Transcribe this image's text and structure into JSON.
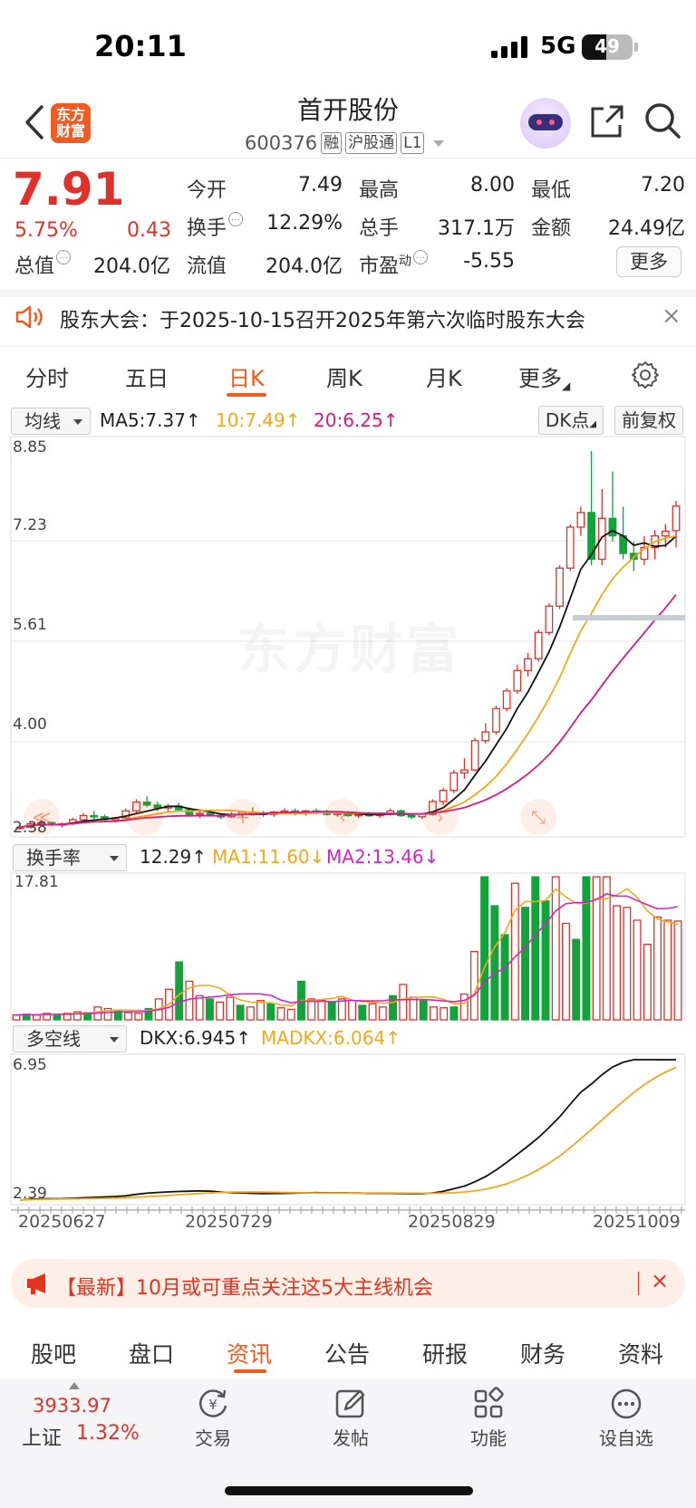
{
  "status_bar": {
    "time": "20:11",
    "network": "5G",
    "battery": "49"
  },
  "header": {
    "name": "首开股份",
    "code": "600376",
    "tags": [
      "融",
      "沪股通",
      "L1"
    ],
    "logo_text": "东方财富"
  },
  "quote": {
    "price": "7.91",
    "change_pct": "5.75%",
    "change": "0.43",
    "fields": [
      {
        "label": "今开",
        "value": "7.49",
        "tone": "red",
        "info": false
      },
      {
        "label": "最高",
        "value": "8.00",
        "tone": "red",
        "info": false
      },
      {
        "label": "最低",
        "value": "7.20",
        "tone": "green",
        "info": false
      },
      {
        "label": "换手",
        "value": "12.29%",
        "tone": "normal",
        "info": true
      },
      {
        "label": "总手",
        "value": "317.1万",
        "tone": "normal",
        "info": false
      },
      {
        "label": "金额",
        "value": "24.49亿",
        "tone": "normal",
        "info": false
      },
      {
        "label": "总值",
        "value": "204.0亿",
        "tone": "normal",
        "info": true
      },
      {
        "label": "流值",
        "value": "204.0亿",
        "tone": "normal",
        "info": false
      },
      {
        "label": "市盈",
        "superscript": "动",
        "value": "-5.55",
        "tone": "normal",
        "info": true
      }
    ],
    "more_label": "更多"
  },
  "notice": {
    "text": "股东大会：于2025-10-15召开2025年第六次临时股东大会",
    "close": "×"
  },
  "period_tabs": [
    "分时",
    "五日",
    "日K",
    "周K",
    "月K",
    "更多"
  ],
  "kline": {
    "indicator_select": "均线",
    "ma5": "MA5:7.37↑",
    "ma10": "10:7.49↑",
    "ma20": "20:6.25↑",
    "dk_button": "DK点",
    "adjust_button": "前复权",
    "y_labels": [
      "8.85",
      "7.23",
      "5.61",
      "4.00",
      "2.38"
    ],
    "watermark": "东方财富"
  },
  "turnover": {
    "select": "换手率",
    "value": "12.29↑",
    "ma1": "MA1:11.60↓",
    "ma2": "MA2:13.46↓",
    "max_label": "17.81"
  },
  "dkx": {
    "select": "多空线",
    "dkx": "DKX:6.945↑",
    "madkx": "MADKX:6.064↑",
    "max_label": "6.95",
    "min_label": "2.39",
    "dates": [
      "20250627",
      "20250729",
      "20250829",
      "20251009"
    ]
  },
  "chart_data": [
    {
      "type": "candlestick",
      "title": "日K",
      "ylim": [
        2.38,
        8.85
      ],
      "x": [
        "20250627",
        "20250729",
        "20250829",
        "20251009"
      ],
      "series": [
        {
          "name": "MA5",
          "last": 7.37
        },
        {
          "name": "10",
          "last": 7.49
        },
        {
          "name": "20",
          "last": 6.25
        }
      ],
      "ohlc_approx": [
        [
          2.4,
          2.45,
          2.38,
          2.42
        ],
        [
          2.42,
          2.5,
          2.4,
          2.48
        ],
        [
          2.48,
          2.55,
          2.45,
          2.5
        ],
        [
          2.5,
          2.52,
          2.44,
          2.46
        ],
        [
          2.46,
          2.5,
          2.42,
          2.48
        ],
        [
          2.48,
          2.58,
          2.46,
          2.55
        ],
        [
          2.55,
          2.66,
          2.5,
          2.62
        ],
        [
          2.62,
          2.7,
          2.56,
          2.6
        ],
        [
          2.6,
          2.64,
          2.52,
          2.55
        ],
        [
          2.55,
          2.6,
          2.5,
          2.58
        ],
        [
          2.58,
          2.74,
          2.56,
          2.7
        ],
        [
          2.7,
          2.9,
          2.66,
          2.85
        ],
        [
          2.85,
          2.95,
          2.76,
          2.8
        ],
        [
          2.8,
          2.86,
          2.7,
          2.75
        ],
        [
          2.75,
          2.82,
          2.68,
          2.78
        ],
        [
          2.78,
          2.84,
          2.7,
          2.72
        ],
        [
          2.72,
          2.76,
          2.6,
          2.64
        ],
        [
          2.64,
          2.7,
          2.58,
          2.66
        ],
        [
          2.66,
          2.72,
          2.6,
          2.62
        ],
        [
          2.62,
          2.66,
          2.56,
          2.6
        ],
        [
          2.6,
          2.68,
          2.58,
          2.64
        ],
        [
          2.64,
          2.7,
          2.6,
          2.68
        ],
        [
          2.68,
          2.76,
          2.62,
          2.66
        ],
        [
          2.66,
          2.7,
          2.6,
          2.64
        ],
        [
          2.64,
          2.7,
          2.6,
          2.68
        ],
        [
          2.68,
          2.74,
          2.64,
          2.7
        ],
        [
          2.7,
          2.74,
          2.62,
          2.66
        ],
        [
          2.66,
          2.72,
          2.62,
          2.7
        ],
        [
          2.7,
          2.74,
          2.64,
          2.68
        ],
        [
          2.68,
          2.72,
          2.62,
          2.64
        ],
        [
          2.64,
          2.7,
          2.6,
          2.66
        ],
        [
          2.66,
          2.7,
          2.6,
          2.62
        ],
        [
          2.62,
          2.66,
          2.58,
          2.64
        ],
        [
          2.64,
          2.68,
          2.6,
          2.62
        ],
        [
          2.62,
          2.68,
          2.58,
          2.66
        ],
        [
          2.66,
          2.74,
          2.62,
          2.7
        ],
        [
          2.7,
          2.72,
          2.6,
          2.62
        ],
        [
          2.62,
          2.66,
          2.56,
          2.6
        ],
        [
          2.6,
          2.66,
          2.56,
          2.64
        ],
        [
          2.64,
          2.9,
          2.62,
          2.86
        ],
        [
          2.86,
          3.1,
          2.8,
          3.05
        ],
        [
          3.05,
          3.4,
          3.0,
          3.35
        ],
        [
          3.35,
          3.6,
          3.25,
          3.4
        ],
        [
          3.4,
          3.95,
          3.38,
          3.9
        ],
        [
          3.9,
          4.2,
          3.85,
          4.05
        ],
        [
          4.05,
          4.5,
          4.0,
          4.45
        ],
        [
          4.45,
          4.8,
          4.4,
          4.75
        ],
        [
          4.75,
          5.2,
          4.7,
          5.1
        ],
        [
          5.1,
          5.4,
          5.0,
          5.3
        ],
        [
          5.3,
          5.8,
          5.25,
          5.75
        ],
        [
          5.75,
          6.25,
          5.7,
          6.2
        ],
        [
          6.2,
          6.9,
          6.15,
          6.85
        ],
        [
          6.85,
          7.6,
          6.8,
          7.55
        ],
        [
          7.55,
          7.9,
          7.4,
          7.8
        ],
        [
          7.8,
          8.85,
          6.9,
          7.0
        ],
        [
          7.0,
          8.2,
          6.9,
          7.7
        ],
        [
          7.7,
          8.5,
          7.3,
          7.4
        ],
        [
          7.4,
          7.9,
          7.0,
          7.1
        ],
        [
          7.1,
          7.3,
          6.8,
          7.0
        ],
        [
          7.0,
          7.4,
          6.9,
          7.2
        ],
        [
          7.2,
          7.5,
          7.0,
          7.4
        ],
        [
          7.4,
          7.6,
          7.2,
          7.48
        ],
        [
          7.49,
          8.0,
          7.2,
          7.91
        ]
      ]
    },
    {
      "type": "bar",
      "title": "换手率",
      "ylim": [
        0,
        17.81
      ],
      "series": [
        {
          "name": "MA1",
          "last": 11.6
        },
        {
          "name": "MA2",
          "last": 13.46
        }
      ],
      "values_approx": [
        0.6,
        0.7,
        0.6,
        0.8,
        0.7,
        0.8,
        1.0,
        0.9,
        1.6,
        1.4,
        1.2,
        0.9,
        0.8,
        1.4,
        2.6,
        3.8,
        7.2,
        4.8,
        3.0,
        2.6,
        2.2,
        2.8,
        1.8,
        1.6,
        2.4,
        2.0,
        1.5,
        1.3,
        4.8,
        2.6,
        2.4,
        2.2,
        2.6,
        2.4,
        1.8,
        2.0,
        1.6,
        3.0,
        4.4,
        2.8,
        2.4,
        1.6,
        1.5,
        1.6,
        3.2,
        8.5,
        17.8,
        14.2,
        10.6,
        17.0,
        14.0,
        17.8,
        14.8,
        17.8,
        12.0,
        10.0,
        17.8,
        17.8,
        17.8,
        14.2,
        14.0,
        12.4,
        9.4,
        12.8,
        12.4,
        12.29
      ]
    },
    {
      "type": "line",
      "title": "多空线",
      "ylim": [
        2.39,
        6.95
      ],
      "x": [
        "20250627",
        "20250729",
        "20250829",
        "20251009"
      ],
      "series": [
        {
          "name": "DKX",
          "last": 6.945
        },
        {
          "name": "MADKX",
          "last": 6.064
        }
      ]
    }
  ],
  "banner": {
    "text": "【最新】10月或可重点关注这5大主线机会",
    "close": "×"
  },
  "bottom_tabs": [
    "股吧",
    "盘口",
    "资讯",
    "公告",
    "研报",
    "财务",
    "资料"
  ],
  "toolbar": {
    "index_value": "3933.97",
    "index_name": "上证",
    "index_pct": "1.32%",
    "tools": [
      "交易",
      "发帖",
      "功能",
      "设自选"
    ]
  }
}
